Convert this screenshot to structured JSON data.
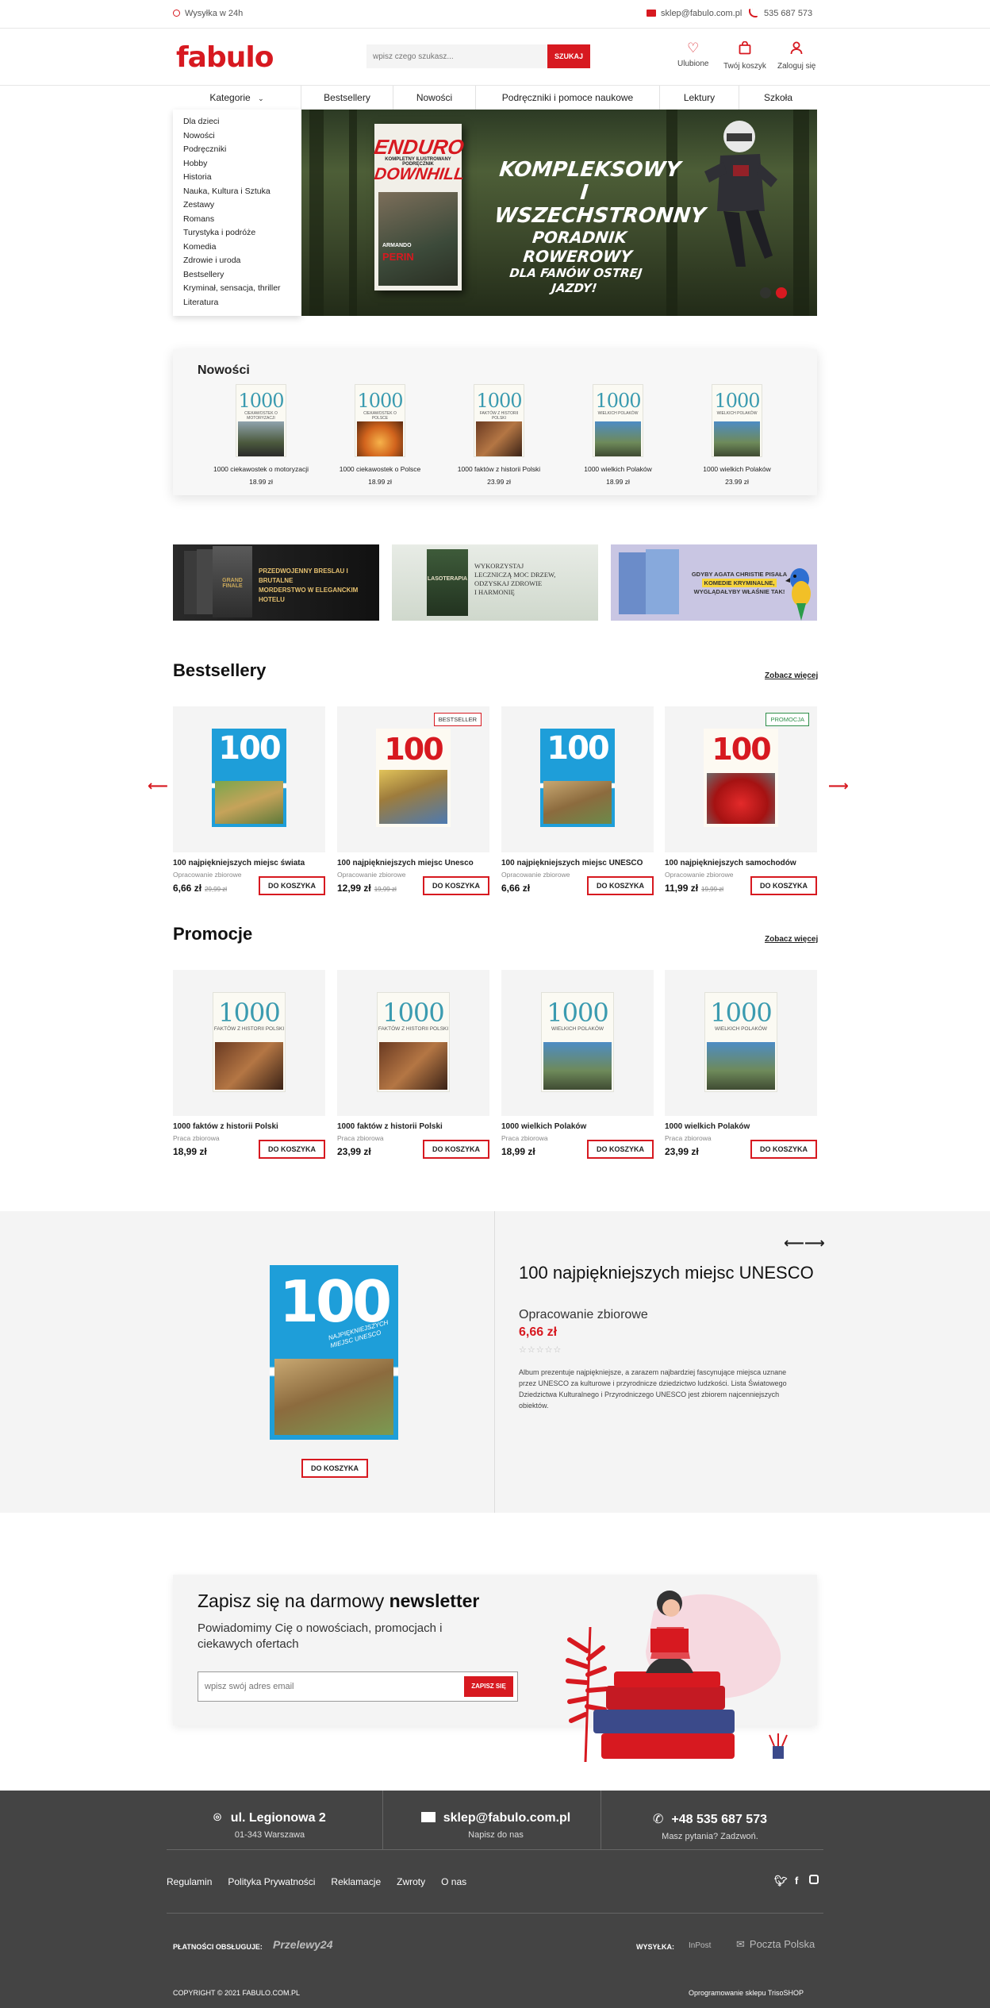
{
  "topbar": {
    "shipping": "Wysyłka w 24h",
    "email": "sklep@fabulo.com.pl",
    "phone": "535 687 573"
  },
  "header": {
    "logo": "fabulo",
    "search_placeholder": "wpisz czego szukasz...",
    "search_button": "SZUKAJ",
    "favorites": "Ulubione",
    "cart": "Twój koszyk",
    "login": "Zaloguj się"
  },
  "nav": {
    "items": [
      "Kategorie",
      "Bestsellery",
      "Nowości",
      "Podręczniki i pomoce naukowe",
      "Lektury",
      "Szkoła"
    ]
  },
  "categories": [
    "Dla dzieci",
    "Nowości",
    "Podręczniki",
    "Hobby",
    "Historia",
    "Nauka, Kultura i Sztuka",
    "Zestawy",
    "Romans",
    "Turystyka i podróże",
    "Komedia",
    "Zdrowie i uroda",
    "Bestsellery",
    "Kryminał, sensacja, thriller",
    "Literatura"
  ],
  "hero": {
    "book_title1": "ENDURO",
    "book_title2": "DOWNHILL",
    "book_subtitle": "KOMPLETNY ILUSTROWANY PODRĘCZNIK",
    "author1": "ARMANDO",
    "author2": "PERIN",
    "line1": "KOMPLEKSOWY",
    "line2": "I WSZECHSTRONNY",
    "line3": "PORADNIK ROWEROWY",
    "line4": "DLA FANÓW OSTREJ JAZDY!"
  },
  "nowosci": {
    "title": "Nowości",
    "items": [
      {
        "num": "1000",
        "sub": "CIEKAWOSTEK O MOTORYZACJI",
        "title": "1000 ciekawostek o motoryzacji",
        "price": "18.99 zł"
      },
      {
        "num": "1000",
        "sub": "CIEKAWOSTEK O POLSCE",
        "title": "1000 ciekawostek o Polsce",
        "price": "18.99 zł"
      },
      {
        "num": "1000",
        "sub": "FAKTÓW Z HISTORII POLSKI",
        "title": "1000 faktów z historii Polski",
        "price": "23.99 zł"
      },
      {
        "num": "1000",
        "sub": "WIELKICH POLAKÓW",
        "title": "1000 wielkich Polaków",
        "price": "18.99 zł"
      },
      {
        "num": "1000",
        "sub": "WIELKICH POLAKÓW",
        "title": "1000 wielkich Polaków",
        "price": "23.99 zł"
      }
    ]
  },
  "banners": {
    "b1_line1": "PRZEDWOJENNY BRESLAU I BRUTALNE",
    "b1_line2": "MORDERSTWO W ELEGANCKIM HOTELU",
    "b1_book": "GRAND FINALE",
    "b2_line1": "WYKORZYSTAJ",
    "b2_line2": "LECZNICZĄ MOC DRZEW,",
    "b2_line3": "ODZYSKAJ ZDROWIE",
    "b2_line4": "I HARMONIĘ",
    "b2_book": "LASOTERAPIA",
    "b3_line1": "GDYBY AGATA CHRISTIE PISAŁA",
    "b3_line2": "KOMEDIE KRYMINALNE,",
    "b3_line3": "WYGLĄDAŁYBY WŁAŚNIE TAK!"
  },
  "bestsellery": {
    "title": "Bestsellery",
    "more": "Zobacz więcej",
    "items": [
      {
        "badge": "",
        "num": "100",
        "title": "100 najpiękniejszych miejsc świata",
        "author": "Opracowanie zbiorowe",
        "price": "6,66 zł",
        "old": "29,99 zł",
        "button": "DO KOSZYKA"
      },
      {
        "badge": "BESTSELLER",
        "num": "100",
        "title": "100 najpiękniejszych miejsc Unesco",
        "author": "Opracowanie zbiorowe",
        "price": "12,99 zł",
        "old": "19,99 zł",
        "button": "DO KOSZYKA"
      },
      {
        "badge": "",
        "num": "100",
        "title": "100 najpiękniejszych miejsc UNESCO",
        "author": "Opracowanie zbiorowe",
        "price": "6,66 zł",
        "old": "",
        "button": "DO KOSZYKA"
      },
      {
        "badge": "PROMOCJA",
        "num": "100",
        "title": "100 najpiękniejszych samochodów",
        "author": "Opracowanie zbiorowe",
        "price": "11,99 zł",
        "old": "19,99 zł",
        "button": "DO KOSZYKA"
      }
    ]
  },
  "promocje": {
    "title": "Promocje",
    "more": "Zobacz więcej",
    "items": [
      {
        "num": "1000",
        "sub": "FAKTÓW Z HISTORII POLSKI",
        "title": "1000 faktów z historii Polski",
        "author": "Praca zbiorowa",
        "price": "18,99 zł",
        "button": "DO KOSZYKA"
      },
      {
        "num": "1000",
        "sub": "FAKTÓW Z HISTORII POLSKI",
        "title": "1000 faktów z historii Polski",
        "author": "Praca zbiorowa",
        "price": "23,99 zł",
        "button": "DO KOSZYKA"
      },
      {
        "num": "1000",
        "sub": "WIELKICH POLAKÓW",
        "title": "1000 wielkich Polaków",
        "author": "Praca zbiorowa",
        "price": "18,99 zł",
        "button": "DO KOSZYKA"
      },
      {
        "num": "1000",
        "sub": "WIELKICH POLAKÓW",
        "title": "1000 wielkich Polaków",
        "author": "Praca zbiorowa",
        "price": "23,99 zł",
        "button": "DO KOSZYKA"
      }
    ]
  },
  "featured": {
    "num": "100",
    "sub": "NAJPIĘKNIEJSZYCH MIEJSC UNESCO",
    "title": "100 najpiękniejszych miejsc UNESCO",
    "author": "Opracowanie zbiorowe",
    "price": "6,66 zł",
    "stars": "☆☆☆☆☆",
    "desc": "Album prezentuje najpiękniejsze, a zarazem najbardziej fascynujące miejsca uznane przez UNESCO za kulturowe i przyrodnicze dziedzictwo ludzkości. Lista Światowego Dziedzictwa Kulturalnego i Przyrodniczego UNESCO jest zbiorem najcenniejszych obiektów.",
    "button": "DO KOSZYKA"
  },
  "newsletter": {
    "title_plain": "Zapisz się na darmowy ",
    "title_bold": "newsletter",
    "subtitle": "Powiadomimy Cię o nowościach, promocjach i ciekawych ofertach",
    "placeholder": "wpisz swój adres email",
    "button": "ZAPISZ SIĘ"
  },
  "footer": {
    "address": "ul. Legionowa 2",
    "city": "01-343 Warszawa",
    "email": "sklep@fabulo.com.pl",
    "email_sub": "Napisz do nas",
    "phone": "+48 535 687 573",
    "phone_sub": "Masz pytania? Zadzwoń.",
    "links": [
      "Regulamin",
      "Polityka Prywatności",
      "Reklamacje",
      "Zwroty",
      "O nas"
    ],
    "payments_label": "PŁATNOŚCI OBSŁUGUJE:",
    "payments_logo": "Przelewy24",
    "shipping_label": "WYSYŁKA:",
    "shipping_logo1": "InPost",
    "shipping_logo2": "Poczta Polska",
    "copyright": "COPYRIGHT © 2021 FABULO.COM.PL",
    "credits": "Oprogramowanie sklepu TrisoSHOP"
  },
  "colors": {
    "accent": "#d71920",
    "footer_bg": "#444444"
  }
}
